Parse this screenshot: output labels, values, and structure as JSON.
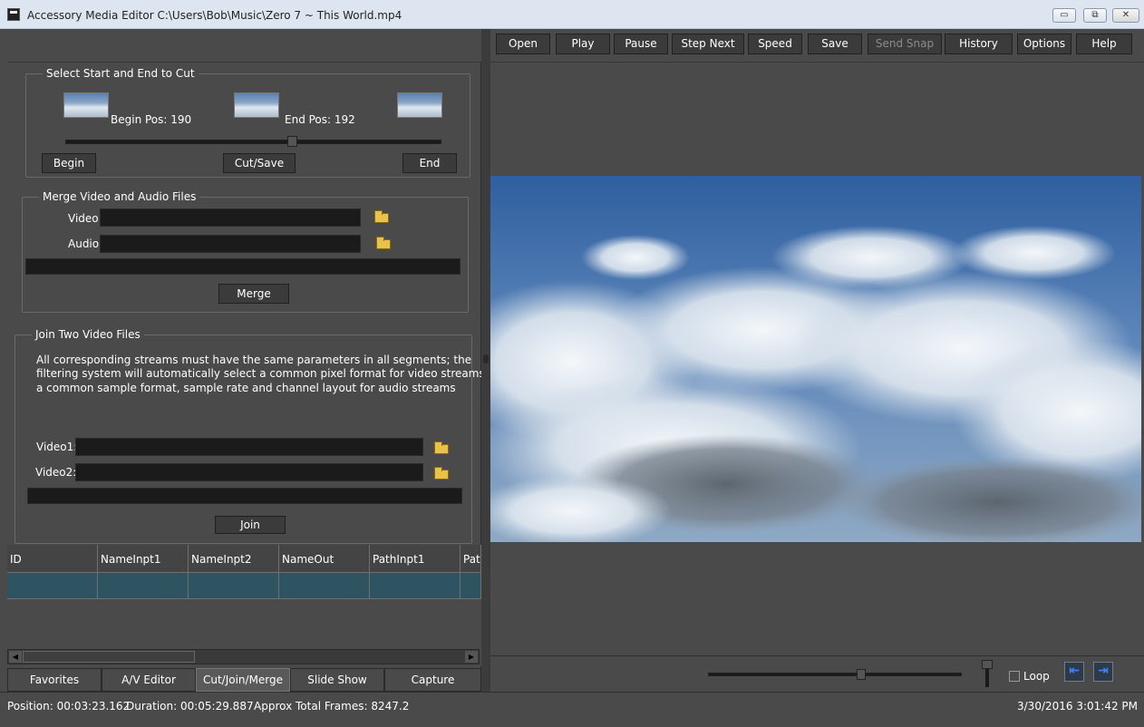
{
  "window": {
    "title": "Accessory Media Editor C:\\Users\\Bob\\Music\\Zero 7 ~ This World.mp4",
    "controls": {
      "minimize": "▭",
      "restore": "⧉",
      "close": "✕"
    }
  },
  "cut": {
    "legend": "Select Start and End to Cut",
    "begin_pos": "Begin Pos: 190",
    "end_pos": "End Pos: 192",
    "slider_fraction": 0.6,
    "begin_button": "Begin",
    "cutsave_button": "Cut/Save",
    "end_button": "End"
  },
  "merge": {
    "legend": "Merge Video and Audio Files",
    "video_label": "Video:",
    "audio_label": "Audio:",
    "video_value": "",
    "audio_value": "",
    "merge_button": "Merge"
  },
  "join": {
    "legend": "Join Two Video Files",
    "description_lines": [
      "All corresponding streams must have the same parameters in all segments; the",
      "filtering system will automatically select a common pixel format for video streams, and",
      "a common sample format, sample rate and channel layout for audio streams"
    ],
    "video1_label": "Video1:",
    "video2_label": "Video2:",
    "join_button": "Join"
  },
  "grid": {
    "columns": [
      "ID",
      "NameInpt1",
      "NameInpt2",
      "NameOut",
      "PathInpt1",
      "Path"
    ],
    "rows": [
      [
        "",
        "",
        "",
        "",
        "",
        ""
      ]
    ]
  },
  "tabs": [
    "Favorites",
    "A/V Editor",
    "Cut/Join/Merge",
    "Slide Show",
    "Capture"
  ],
  "active_tab": "Cut/Join/Merge",
  "toolbar": {
    "open": "Open",
    "play": "Play",
    "pause": "Pause",
    "step_next": "Step Next",
    "speed": "Speed",
    "save": "Save",
    "send_snap": "Send Snap",
    "history": "History",
    "options": "Options",
    "help": "Help"
  },
  "player": {
    "seek_fraction": 0.6,
    "volume_fraction": 1.0,
    "loop_label": "Loop",
    "loop_checked": false,
    "prev_icon": "prev-frame-icon",
    "next_icon": "next-frame-icon"
  },
  "status": {
    "position": "Position: 00:03:23.162",
    "duration": "Duration: 00:05:29.887",
    "frames": "Approx Total Frames: 8247.2",
    "datetime": "3/30/2016 3:01:42 PM"
  },
  "colors": {
    "panel_bg": "#4a4a4a",
    "input_bg": "#1b1b1b",
    "grid_row": "#2e5461",
    "nav_icon": "#3b84ff",
    "titlebar": "#dde6f0"
  }
}
